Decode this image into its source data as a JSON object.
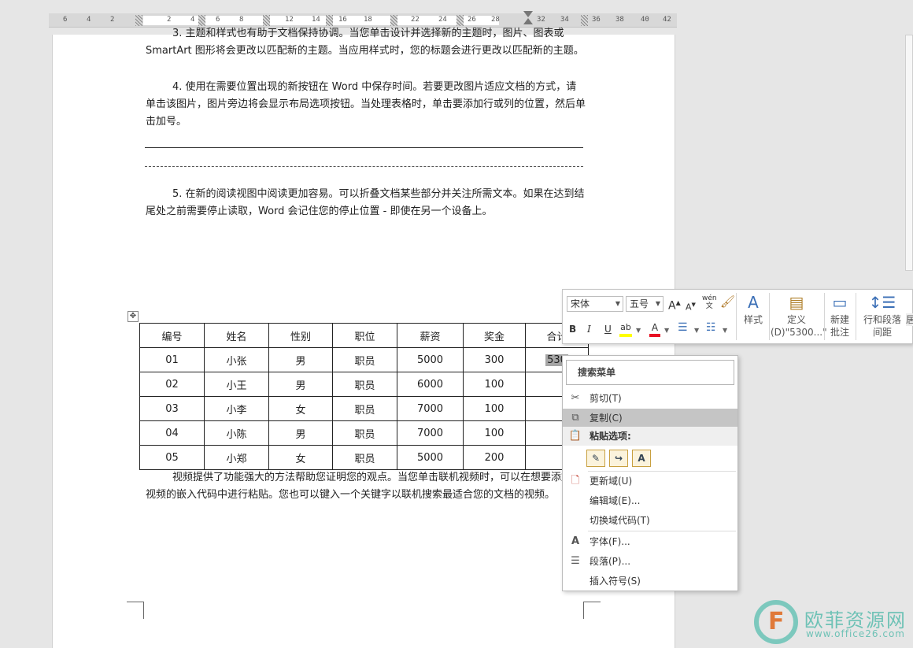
{
  "ruler": {
    "labels": [
      "6",
      "4",
      "2",
      "2",
      "4",
      "6",
      "8",
      "10",
      "12",
      "14",
      "16",
      "18",
      "22",
      "24",
      "26",
      "28",
      "32",
      "34",
      "36",
      "38",
      "40",
      "42"
    ]
  },
  "document": {
    "p1": "3. 主题和样式也有助于文档保持协调。当您单击设计并选择新的主题时，图片、图表或 SmartArt 图形将会更改以匹配新的主题。当应用样式时，您的标题会进行更改以匹配新的主题。",
    "p2": "4. 使用在需要位置出现的新按钮在 Word 中保存时间。若要更改图片适应文档的方式，请单击该图片，图片旁边将会显示布局选项按钮。当处理表格时，单击要添加行或列的位置，然后单击加号。",
    "p3": "5. 在新的阅读视图中阅读更加容易。可以折叠文档某些部分并关注所需文本。如果在达到结尾处之前需要停止读取，Word 会记住您的停止位置 - 即使在另一个设备上。",
    "p4": "视频提供了功能强大的方法帮助您证明您的观点。当您单击联机视频时，可以在想要添加的视频的嵌入代码中进行粘贴。您也可以键入一个关键字以联机搜索最适合您的文档的视频。"
  },
  "table": {
    "headers": [
      "编号",
      "姓名",
      "性别",
      "职位",
      "薪资",
      "奖金",
      "合计"
    ],
    "rows": [
      [
        "01",
        "小张",
        "男",
        "职员",
        "5000",
        "300",
        "530"
      ],
      [
        "02",
        "小王",
        "男",
        "职员",
        "6000",
        "100",
        ""
      ],
      [
        "03",
        "小李",
        "女",
        "职员",
        "7000",
        "100",
        ""
      ],
      [
        "04",
        "小陈",
        "男",
        "职员",
        "7000",
        "100",
        ""
      ],
      [
        "05",
        "小郑",
        "女",
        "职员",
        "5000",
        "200",
        ""
      ]
    ]
  },
  "mini_toolbar": {
    "font": "宋体",
    "size": "五号",
    "grow": "A",
    "shrink": "A",
    "phonetic": "wén",
    "bold": "B",
    "italic": "I",
    "underline": "U",
    "highlight": "ab",
    "font_color": "A",
    "styles_label": "样式",
    "define_label_1": "定义",
    "define_label_2": "(D)\"5300...\"",
    "new_comment_1": "新建",
    "new_comment_2": "批注",
    "spacing_1": "行和段落",
    "spacing_2": "间距",
    "more_label": "居",
    "accent_color": "#3b6fb6",
    "highlight_color": "#ffff00",
    "font_color_bar": "#e81123"
  },
  "context_menu": {
    "search_placeholder": "搜索菜单",
    "items": [
      {
        "label": "剪切(T)",
        "icon": "scissors-icon"
      },
      {
        "label": "复制(C)",
        "icon": "copy-icon"
      },
      {
        "label": "粘贴选项:",
        "icon": "paste-icon"
      },
      {
        "label": "更新域(U)",
        "icon": "update-field-icon"
      },
      {
        "label": "编辑域(E)...",
        "icon": ""
      },
      {
        "label": "切换域代码(T)",
        "icon": ""
      },
      {
        "label": "字体(F)...",
        "icon": "font-icon"
      },
      {
        "label": "段落(P)...",
        "icon": "paragraph-icon"
      },
      {
        "label": "插入符号(S)",
        "icon": ""
      }
    ],
    "paste_options": [
      "keep-source-formatting-icon",
      "merge-formatting-icon",
      "keep-text-only-icon"
    ]
  },
  "watermark": {
    "title": "欧菲资源网",
    "url": "www.office26.com",
    "brand_color": "#6fc2b6"
  }
}
